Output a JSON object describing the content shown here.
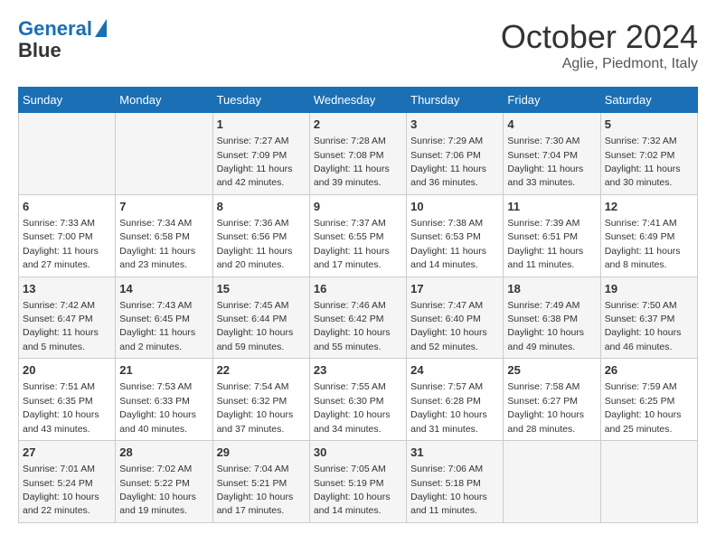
{
  "header": {
    "logo_line1": "General",
    "logo_line2": "Blue",
    "month": "October 2024",
    "location": "Aglie, Piedmont, Italy"
  },
  "weekdays": [
    "Sunday",
    "Monday",
    "Tuesday",
    "Wednesday",
    "Thursday",
    "Friday",
    "Saturday"
  ],
  "weeks": [
    [
      {
        "day": "",
        "sunrise": "",
        "sunset": "",
        "daylight": ""
      },
      {
        "day": "",
        "sunrise": "",
        "sunset": "",
        "daylight": ""
      },
      {
        "day": "1",
        "sunrise": "Sunrise: 7:27 AM",
        "sunset": "Sunset: 7:09 PM",
        "daylight": "Daylight: 11 hours and 42 minutes."
      },
      {
        "day": "2",
        "sunrise": "Sunrise: 7:28 AM",
        "sunset": "Sunset: 7:08 PM",
        "daylight": "Daylight: 11 hours and 39 minutes."
      },
      {
        "day": "3",
        "sunrise": "Sunrise: 7:29 AM",
        "sunset": "Sunset: 7:06 PM",
        "daylight": "Daylight: 11 hours and 36 minutes."
      },
      {
        "day": "4",
        "sunrise": "Sunrise: 7:30 AM",
        "sunset": "Sunset: 7:04 PM",
        "daylight": "Daylight: 11 hours and 33 minutes."
      },
      {
        "day": "5",
        "sunrise": "Sunrise: 7:32 AM",
        "sunset": "Sunset: 7:02 PM",
        "daylight": "Daylight: 11 hours and 30 minutes."
      }
    ],
    [
      {
        "day": "6",
        "sunrise": "Sunrise: 7:33 AM",
        "sunset": "Sunset: 7:00 PM",
        "daylight": "Daylight: 11 hours and 27 minutes."
      },
      {
        "day": "7",
        "sunrise": "Sunrise: 7:34 AM",
        "sunset": "Sunset: 6:58 PM",
        "daylight": "Daylight: 11 hours and 23 minutes."
      },
      {
        "day": "8",
        "sunrise": "Sunrise: 7:36 AM",
        "sunset": "Sunset: 6:56 PM",
        "daylight": "Daylight: 11 hours and 20 minutes."
      },
      {
        "day": "9",
        "sunrise": "Sunrise: 7:37 AM",
        "sunset": "Sunset: 6:55 PM",
        "daylight": "Daylight: 11 hours and 17 minutes."
      },
      {
        "day": "10",
        "sunrise": "Sunrise: 7:38 AM",
        "sunset": "Sunset: 6:53 PM",
        "daylight": "Daylight: 11 hours and 14 minutes."
      },
      {
        "day": "11",
        "sunrise": "Sunrise: 7:39 AM",
        "sunset": "Sunset: 6:51 PM",
        "daylight": "Daylight: 11 hours and 11 minutes."
      },
      {
        "day": "12",
        "sunrise": "Sunrise: 7:41 AM",
        "sunset": "Sunset: 6:49 PM",
        "daylight": "Daylight: 11 hours and 8 minutes."
      }
    ],
    [
      {
        "day": "13",
        "sunrise": "Sunrise: 7:42 AM",
        "sunset": "Sunset: 6:47 PM",
        "daylight": "Daylight: 11 hours and 5 minutes."
      },
      {
        "day": "14",
        "sunrise": "Sunrise: 7:43 AM",
        "sunset": "Sunset: 6:45 PM",
        "daylight": "Daylight: 11 hours and 2 minutes."
      },
      {
        "day": "15",
        "sunrise": "Sunrise: 7:45 AM",
        "sunset": "Sunset: 6:44 PM",
        "daylight": "Daylight: 10 hours and 59 minutes."
      },
      {
        "day": "16",
        "sunrise": "Sunrise: 7:46 AM",
        "sunset": "Sunset: 6:42 PM",
        "daylight": "Daylight: 10 hours and 55 minutes."
      },
      {
        "day": "17",
        "sunrise": "Sunrise: 7:47 AM",
        "sunset": "Sunset: 6:40 PM",
        "daylight": "Daylight: 10 hours and 52 minutes."
      },
      {
        "day": "18",
        "sunrise": "Sunrise: 7:49 AM",
        "sunset": "Sunset: 6:38 PM",
        "daylight": "Daylight: 10 hours and 49 minutes."
      },
      {
        "day": "19",
        "sunrise": "Sunrise: 7:50 AM",
        "sunset": "Sunset: 6:37 PM",
        "daylight": "Daylight: 10 hours and 46 minutes."
      }
    ],
    [
      {
        "day": "20",
        "sunrise": "Sunrise: 7:51 AM",
        "sunset": "Sunset: 6:35 PM",
        "daylight": "Daylight: 10 hours and 43 minutes."
      },
      {
        "day": "21",
        "sunrise": "Sunrise: 7:53 AM",
        "sunset": "Sunset: 6:33 PM",
        "daylight": "Daylight: 10 hours and 40 minutes."
      },
      {
        "day": "22",
        "sunrise": "Sunrise: 7:54 AM",
        "sunset": "Sunset: 6:32 PM",
        "daylight": "Daylight: 10 hours and 37 minutes."
      },
      {
        "day": "23",
        "sunrise": "Sunrise: 7:55 AM",
        "sunset": "Sunset: 6:30 PM",
        "daylight": "Daylight: 10 hours and 34 minutes."
      },
      {
        "day": "24",
        "sunrise": "Sunrise: 7:57 AM",
        "sunset": "Sunset: 6:28 PM",
        "daylight": "Daylight: 10 hours and 31 minutes."
      },
      {
        "day": "25",
        "sunrise": "Sunrise: 7:58 AM",
        "sunset": "Sunset: 6:27 PM",
        "daylight": "Daylight: 10 hours and 28 minutes."
      },
      {
        "day": "26",
        "sunrise": "Sunrise: 7:59 AM",
        "sunset": "Sunset: 6:25 PM",
        "daylight": "Daylight: 10 hours and 25 minutes."
      }
    ],
    [
      {
        "day": "27",
        "sunrise": "Sunrise: 7:01 AM",
        "sunset": "Sunset: 5:24 PM",
        "daylight": "Daylight: 10 hours and 22 minutes."
      },
      {
        "day": "28",
        "sunrise": "Sunrise: 7:02 AM",
        "sunset": "Sunset: 5:22 PM",
        "daylight": "Daylight: 10 hours and 19 minutes."
      },
      {
        "day": "29",
        "sunrise": "Sunrise: 7:04 AM",
        "sunset": "Sunset: 5:21 PM",
        "daylight": "Daylight: 10 hours and 17 minutes."
      },
      {
        "day": "30",
        "sunrise": "Sunrise: 7:05 AM",
        "sunset": "Sunset: 5:19 PM",
        "daylight": "Daylight: 10 hours and 14 minutes."
      },
      {
        "day": "31",
        "sunrise": "Sunrise: 7:06 AM",
        "sunset": "Sunset: 5:18 PM",
        "daylight": "Daylight: 10 hours and 11 minutes."
      },
      {
        "day": "",
        "sunrise": "",
        "sunset": "",
        "daylight": ""
      },
      {
        "day": "",
        "sunrise": "",
        "sunset": "",
        "daylight": ""
      }
    ]
  ]
}
